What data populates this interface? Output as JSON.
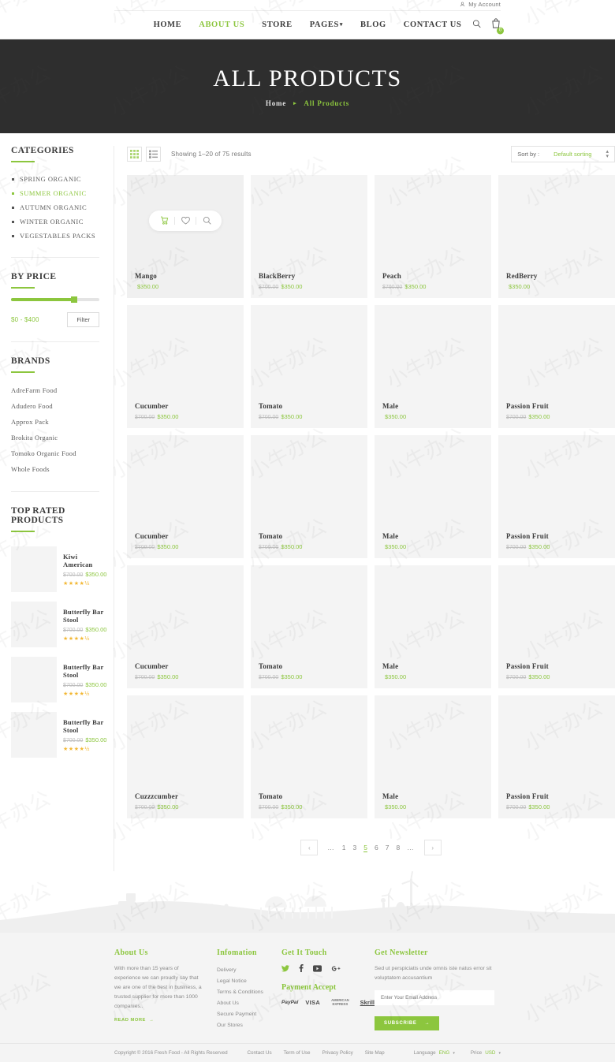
{
  "topbar": {
    "account_label": "My Account",
    "account_icon": "user-icon"
  },
  "nav": {
    "items": [
      {
        "label": "HOME",
        "active": false,
        "caret": false
      },
      {
        "label": "ABOUT US",
        "active": true,
        "caret": false
      },
      {
        "label": "STORE",
        "active": false,
        "caret": false
      },
      {
        "label": "PAGES",
        "active": false,
        "caret": true
      },
      {
        "label": "BLOG",
        "active": false,
        "caret": false
      },
      {
        "label": "CONTACT US",
        "active": false,
        "caret": false
      }
    ],
    "search_icon": "search-icon",
    "cart_icon": "shopping-bag-icon",
    "cart_count": "0"
  },
  "hero": {
    "title": "ALL PRODUCTS",
    "breadcrumb_home": "Home",
    "breadcrumb_sep": "▸",
    "breadcrumb_current": "All Products"
  },
  "sidebar": {
    "categories": {
      "title": "CATEGORIES",
      "items": [
        {
          "label": "SPRING ORGANIC",
          "active": false
        },
        {
          "label": "SUMMER ORGANIC",
          "active": true
        },
        {
          "label": "AUTUMN ORGANIC",
          "active": false
        },
        {
          "label": "WINTER ORGANIC",
          "active": false
        },
        {
          "label": "VEGESTABLES PACKS",
          "active": false
        }
      ]
    },
    "price": {
      "title": "BY PRICE",
      "range_label": "$0 - $400",
      "filter_label": "Filter",
      "slider_percent": 70
    },
    "brands": {
      "title": "BRANDS",
      "items": [
        "AdreFarm Food",
        "Adudero Food",
        "Approx Pack",
        "Brokita Organic",
        "Tomoko Organic Food",
        "Whole Foods"
      ]
    },
    "top_rated": {
      "title": "TOP RATED PRODUCTS",
      "items": [
        {
          "name": "Kiwi American",
          "old_price": "$700.00",
          "price": "$350.00",
          "stars": "★★★★½"
        },
        {
          "name": "Butterfly Bar Stool",
          "old_price": "$700.00",
          "price": "$350.00",
          "stars": "★★★★½"
        },
        {
          "name": "Butterfly Bar Stool",
          "old_price": "$700.00",
          "price": "$350.00",
          "stars": "★★★★½"
        },
        {
          "name": "Butterfly Bar Stool",
          "old_price": "$700.00",
          "price": "$350.00",
          "stars": "★★★★½"
        }
      ]
    }
  },
  "toolbar": {
    "grid_icon": "grid-view-icon",
    "list_icon": "list-view-icon",
    "result_count": "Showing 1–20 of 75 results",
    "sort_label": "Sort by :",
    "sort_value": "Default sorting"
  },
  "products": [
    {
      "name": "Mango",
      "old_price": "",
      "price": "$350.00",
      "hovered": true
    },
    {
      "name": "BlackBerry",
      "old_price": "$700.00",
      "price": "$350.00",
      "hovered": false
    },
    {
      "name": "Peach",
      "old_price": "$700.00",
      "price": "$350.00",
      "hovered": false
    },
    {
      "name": "RedBerry",
      "old_price": "",
      "price": "$350.00",
      "hovered": false
    },
    {
      "name": "Cucumber",
      "old_price": "$700.00",
      "price": "$350.00",
      "hovered": false
    },
    {
      "name": "Tomato",
      "old_price": "$700.00",
      "price": "$350.00",
      "hovered": false
    },
    {
      "name": "Male",
      "old_price": "",
      "price": "$350.00",
      "hovered": false
    },
    {
      "name": "Passion Fruit",
      "old_price": "$700.00",
      "price": "$350.00",
      "hovered": false
    },
    {
      "name": "Cucumber",
      "old_price": "$700.00",
      "price": "$350.00",
      "hovered": false
    },
    {
      "name": "Tomato",
      "old_price": "$700.00",
      "price": "$350.00",
      "hovered": false
    },
    {
      "name": "Male",
      "old_price": "",
      "price": "$350.00",
      "hovered": false
    },
    {
      "name": "Passion Fruit",
      "old_price": "$700.00",
      "price": "$350.00",
      "hovered": false
    },
    {
      "name": "Cucumber",
      "old_price": "$700.00",
      "price": "$350.00",
      "hovered": false
    },
    {
      "name": "Tomato",
      "old_price": "$700.00",
      "price": "$350.00",
      "hovered": false
    },
    {
      "name": "Male",
      "old_price": "",
      "price": "$350.00",
      "hovered": false
    },
    {
      "name": "Passion Fruit",
      "old_price": "$700.00",
      "price": "$350.00",
      "hovered": false
    },
    {
      "name": "Cuzzzcumber",
      "old_price": "$700.00",
      "price": "$350.00",
      "hovered": false
    },
    {
      "name": "Tomato",
      "old_price": "$700.00",
      "price": "$350.00",
      "hovered": false
    },
    {
      "name": "Male",
      "old_price": "",
      "price": "$350.00",
      "hovered": false
    },
    {
      "name": "Passion Fruit",
      "old_price": "$700.00",
      "price": "$350.00",
      "hovered": false
    }
  ],
  "hover_actions": [
    {
      "icon": "add-to-cart-icon"
    },
    {
      "icon": "wishlist-heart-icon"
    },
    {
      "icon": "quick-view-search-icon"
    }
  ],
  "pagination": {
    "prev": "‹",
    "next": "›",
    "pages": [
      {
        "label": "…",
        "active": false,
        "dots": true
      },
      {
        "label": "1",
        "active": false,
        "dots": false
      },
      {
        "label": "3",
        "active": false,
        "dots": false
      },
      {
        "label": "5",
        "active": true,
        "dots": false
      },
      {
        "label": "6",
        "active": false,
        "dots": false
      },
      {
        "label": "7",
        "active": false,
        "dots": false
      },
      {
        "label": "8",
        "active": false,
        "dots": false
      },
      {
        "label": "…",
        "active": false,
        "dots": true
      }
    ]
  },
  "footer": {
    "about": {
      "title": "About Us",
      "text": "With more than 15 years of experience we can proudly say that we are one of the best in business, a trusted supplier for more than 1000 companies..",
      "read_more": "READ MORE"
    },
    "information": {
      "title": "Infomation",
      "links": [
        "Delivery",
        "Legal Notice",
        "Terms & Conditions",
        "About Us",
        "Secure Payment",
        "Our Stores"
      ]
    },
    "touch": {
      "title": "Get It Touch",
      "socials": [
        "twitter-icon",
        "facebook-icon",
        "youtube-icon",
        "google-plus-icon"
      ],
      "payment_title": "Payment Accept",
      "payment_logos": [
        "PayPal",
        "VISA",
        "AMERICAN EXPRESS",
        "Skrill"
      ]
    },
    "newsletter": {
      "title": "Get Newsletter",
      "text": "Sed ut perspiciatis unde omnis iste natus error sit voluptatem accusantium",
      "placeholder": "Enter Your Email Address",
      "input_value": "",
      "button_label": "SUBSCRIBE"
    }
  },
  "copybar": {
    "text": "Copyright © 2016 Fresh Food - All Rights Reserved",
    "links": [
      "Contact Us",
      "Term of Use",
      "Privacy Policy",
      "Site Map"
    ],
    "language_key": "Language",
    "language_value": "ENG",
    "price_key": "Price",
    "price_value": "USD"
  },
  "colors": {
    "accent": "#8cc63e",
    "hero_bg": "#2e2e2e",
    "card_bg": "#f4f4f4",
    "star": "#f2b733"
  }
}
